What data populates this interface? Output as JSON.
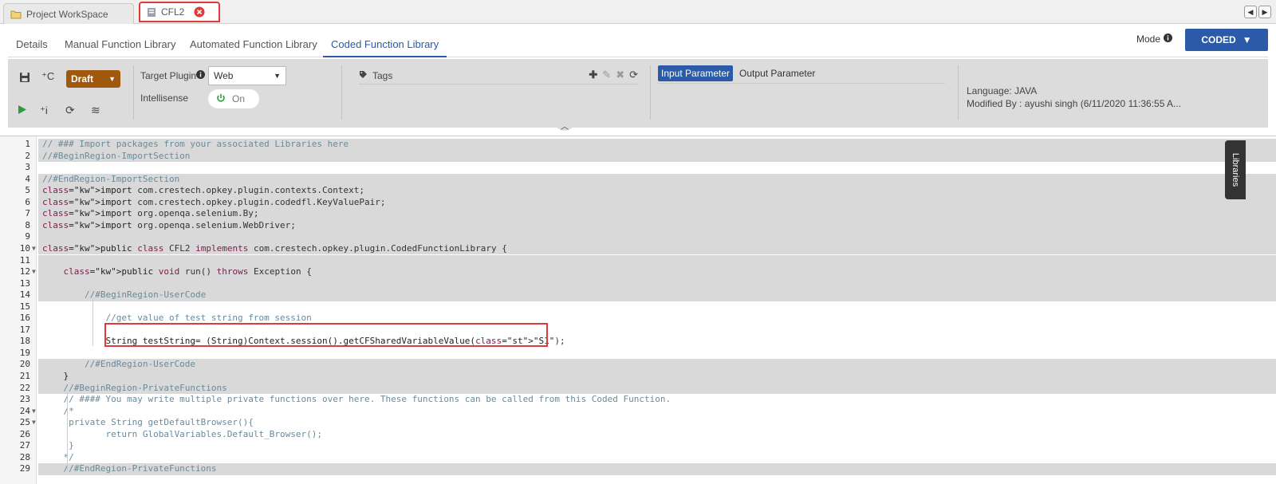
{
  "window_tabs": [
    {
      "label": "Project WorkSpace",
      "icon": "folder-icon"
    },
    {
      "label": "CFL2",
      "icon": "document-icon",
      "close_icon": "close-circle-icon"
    }
  ],
  "library_tabs": [
    {
      "label": "Details"
    },
    {
      "label": "Manual Function Library"
    },
    {
      "label": "Automated Function Library"
    },
    {
      "label": "Coded Function Library",
      "active": true
    }
  ],
  "mode": {
    "label": "Mode",
    "button": "CODED"
  },
  "toolbar": {
    "status": "Draft",
    "target_plugin_label": "Target Plugin",
    "target_plugin_value": "Web",
    "intellisense_label": "Intellisense",
    "intellisense_value": "On",
    "tags_label": "Tags",
    "param_tabs": [
      "Input Parameter",
      "Output Parameter"
    ],
    "language": "Language: JAVA",
    "modified_by": "Modified By : ayushi singh (6/11/2020 11:36:55 A..."
  },
  "libraries_tab": "Libraries",
  "colors": {
    "accent": "#2a5aa8",
    "draft": "#a0580c",
    "highlight": "#e03a3a",
    "panel": "#dcdcdc"
  },
  "code_lines": [
    "// ### Import packages from your associated Libraries here",
    "//#BeginRegion-ImportSection",
    "",
    "//#EndRegion-ImportSection",
    "import com.crestech.opkey.plugin.contexts.Context;",
    "import com.crestech.opkey.plugin.codedfl.KeyValuePair;",
    "import org.openqa.selenium.By;",
    "import org.openqa.selenium.WebDriver;",
    "",
    "public class CFL2 implements com.crestech.opkey.plugin.CodedFunctionLibrary {",
    "",
    "    public void run() throws Exception {",
    "",
    "        //#BeginRegion-UserCode",
    "",
    "            //get value of test string from session",
    "",
    "            String testString= (String)Context.session().getCFSharedVariableValue(\"S1\");",
    "",
    "        //#EndRegion-UserCode",
    "    }",
    "    //#BeginRegion-PrivateFunctions",
    "    // #### You may write multiple private functions over here. These functions can be called from this Coded Function.",
    "    /*",
    "     private String getDefaultBrowser(){",
    "            return GlobalVariables.Default_Browser();",
    "     }",
    "    */",
    "    //#EndRegion-PrivateFunctions"
  ]
}
